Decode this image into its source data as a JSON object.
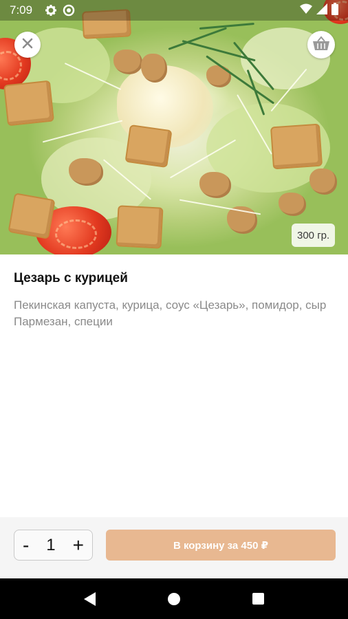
{
  "status_bar": {
    "time": "7:09",
    "icons": [
      "gear-icon",
      "circle-icon",
      "wifi-icon",
      "signal-icon",
      "battery-icon"
    ]
  },
  "hero": {
    "weight_badge": "300 гр.",
    "close_icon": "close-icon",
    "cart_icon": "basket-icon"
  },
  "product": {
    "title": "Цезарь с курицей",
    "description": "Пекинская капуста, курица, соус «Цезарь», помидор, сыр Пармезан, специи"
  },
  "order": {
    "minus_label": "-",
    "quantity": "1",
    "plus_label": "+",
    "add_to_cart_label": "В корзину за 450 ₽"
  },
  "colors": {
    "accent": "#e8b891",
    "order_bar_bg": "#f5f5f5",
    "title": "#111111",
    "description": "#8a8a8a"
  },
  "nav_bar": {
    "icons": [
      "back-icon",
      "home-icon",
      "recents-icon"
    ]
  }
}
